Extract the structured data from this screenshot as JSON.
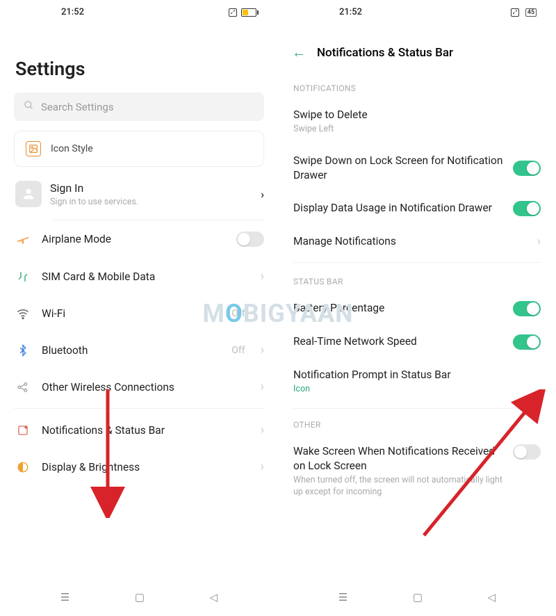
{
  "left": {
    "time": "21:52",
    "title": "Settings",
    "search_placeholder": "Search Settings",
    "icon_style": "Icon Style",
    "signin": {
      "title": "Sign In",
      "sub": "Sign in to use services."
    },
    "items": [
      {
        "label": "Airplane Mode",
        "control": "toggle",
        "on": false
      },
      {
        "label": "SIM Card & Mobile Data",
        "control": "chevron"
      },
      {
        "label": "Wi-Fi",
        "value": "Off",
        "control": "chevron"
      },
      {
        "label": "Bluetooth",
        "value": "Off",
        "control": "chevron"
      },
      {
        "label": "Other Wireless Connections",
        "control": "chevron"
      },
      {
        "label": "Notifications & Status Bar",
        "control": "chevron"
      },
      {
        "label": "Display & Brightness",
        "control": "chevron"
      }
    ]
  },
  "right": {
    "time": "21:52",
    "battery": "45",
    "header": "Notifications & Status Bar",
    "sections": {
      "notifications": {
        "label": "NOTIFICATIONS",
        "rows": [
          {
            "label": "Swipe to Delete",
            "sub": "Swipe Left",
            "control": "none"
          },
          {
            "label": "Swipe Down on Lock Screen for Notification Drawer",
            "control": "toggle",
            "on": true
          },
          {
            "label": "Display Data Usage in Notification Drawer",
            "control": "toggle",
            "on": true
          },
          {
            "label": "Manage Notifications",
            "control": "chevron"
          }
        ]
      },
      "status_bar": {
        "label": "STATUS BAR",
        "rows": [
          {
            "label": "Battery Percentage",
            "control": "toggle",
            "on": true
          },
          {
            "label": "Real-Time Network Speed",
            "control": "toggle",
            "on": true
          },
          {
            "label": "Notification Prompt in Status Bar",
            "sub": "Icon",
            "sub_color": "green",
            "control": "none"
          }
        ]
      },
      "other": {
        "label": "OTHER",
        "rows": [
          {
            "label": "Wake Screen When Notifications Received on Lock Screen",
            "sub": "When turned off, the screen will not automatically light up except for incoming",
            "control": "toggle",
            "on": false
          }
        ]
      }
    }
  },
  "watermark": "MOBIGYAAN"
}
